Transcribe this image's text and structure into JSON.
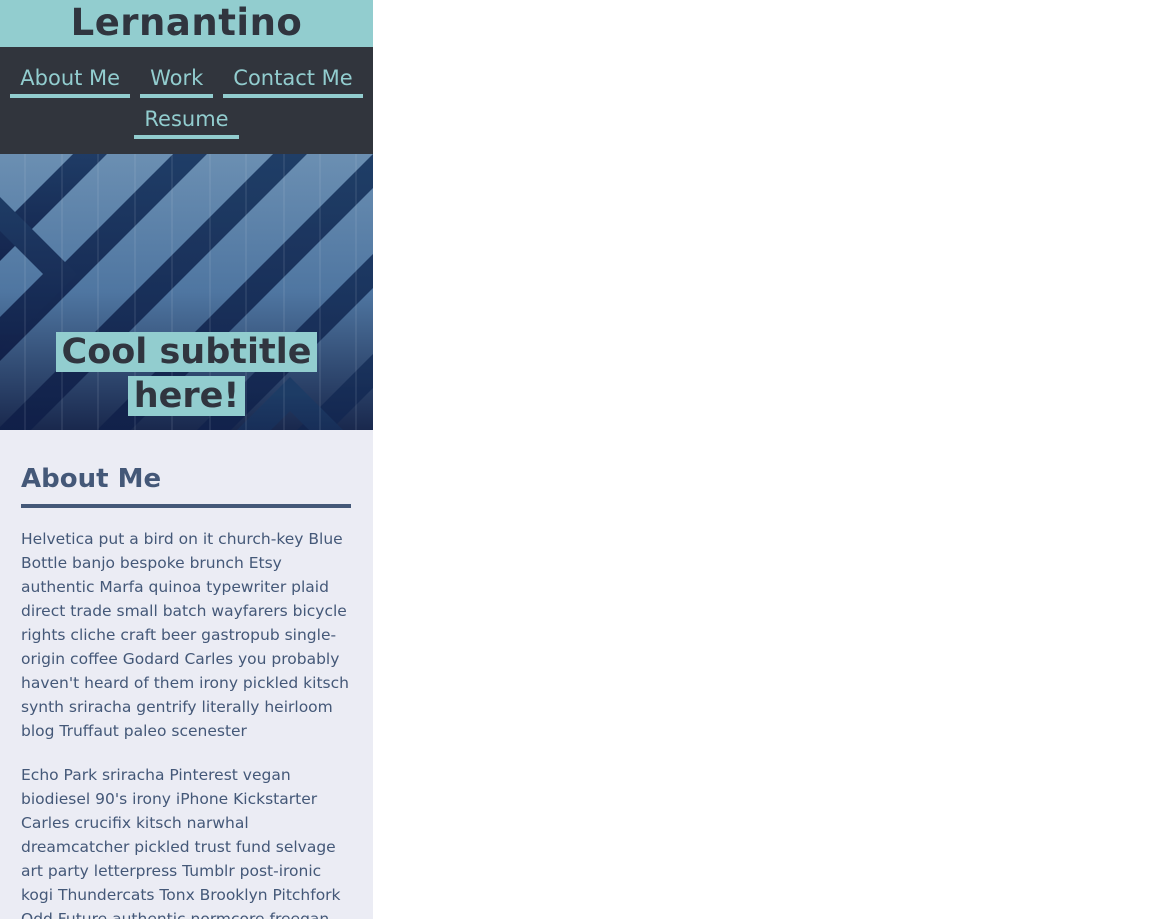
{
  "site": {
    "title": "Lernantino"
  },
  "nav": {
    "items": [
      {
        "label": "About Me"
      },
      {
        "label": "Work"
      },
      {
        "label": "Contact Me"
      },
      {
        "label": "Resume"
      }
    ]
  },
  "hero": {
    "subtitle": "Cool subtitle here!"
  },
  "about": {
    "heading": "About Me",
    "paragraphs": [
      "Helvetica put a bird on it church-key Blue Bottle banjo bespoke brunch Etsy authentic Marfa quinoa typewriter plaid direct trade small batch wayfarers bicycle rights cliche craft beer gastropub single-origin coffee Godard Carles you probably haven't heard of them irony pickled kitsch synth sriracha gentrify literally heirloom blog Truffaut paleo scenester",
      "Echo Park sriracha Pinterest vegan biodiesel 90's irony iPhone Kickstarter Carles crucifix kitsch narwhal dreamcatcher pickled trust fund selvage art party letterpress Tumblr post-ironic kogi Thundercats Tonx Brooklyn Pitchfork Odd Future authentic normcore freegan leggings Schlitz chambray organic"
    ]
  },
  "colors": {
    "header_bg": "#92cdcf",
    "nav_bg": "#31353d",
    "accent": "#92cdcf",
    "text_dark": "#30353f",
    "body_text": "#445878",
    "content_bg": "#ebecf4"
  }
}
